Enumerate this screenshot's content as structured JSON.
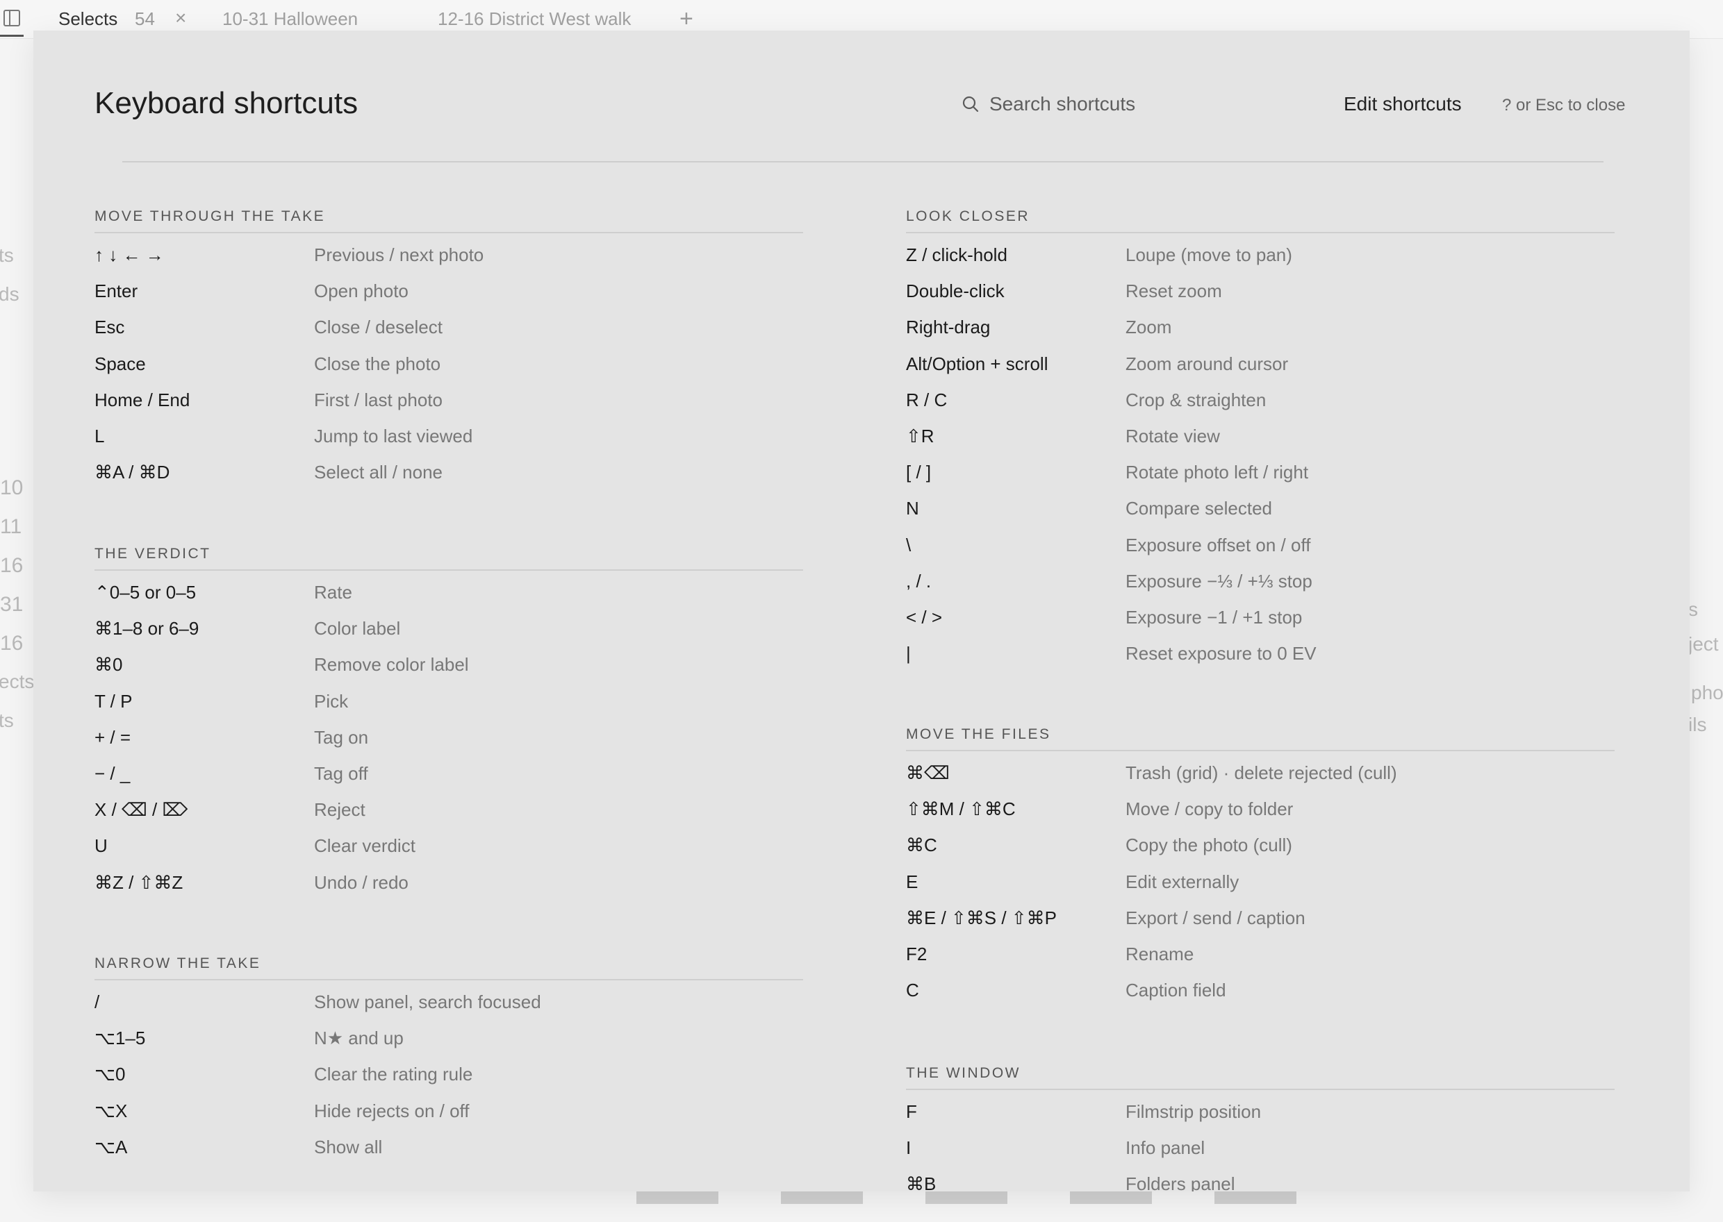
{
  "tabs": [
    {
      "label": "Selects",
      "count": "54"
    },
    {
      "label": "10-31 Halloween"
    },
    {
      "label": "12-16 District West walk"
    }
  ],
  "tab_close_glyph": "×",
  "tab_add_glyph": "+",
  "background_left": [
    "ts",
    "ds",
    "10",
    "11",
    "16",
    "31",
    "16",
    "ects",
    "ts"
  ],
  "background_right": [
    "s",
    "ject",
    "pho",
    "ils"
  ],
  "modal": {
    "title": "Keyboard shortcuts",
    "search_placeholder": "Search shortcuts",
    "edit_label": "Edit shortcuts",
    "close_hint": "? or Esc to close"
  },
  "sections": {
    "move_through": {
      "title": "MOVE THROUGH THE TAKE",
      "rows": [
        {
          "key": "↑ ↓ ← →",
          "desc": "Previous / next photo"
        },
        {
          "key": "Enter",
          "desc": "Open photo"
        },
        {
          "key": "Esc",
          "desc": "Close / deselect"
        },
        {
          "key": "Space",
          "desc": "Close the photo"
        },
        {
          "key": "Home / End",
          "desc": "First / last photo"
        },
        {
          "key": "L",
          "desc": "Jump to last viewed"
        },
        {
          "key": "⌘A / ⌘D",
          "desc": "Select all / none"
        }
      ]
    },
    "verdict": {
      "title": "THE VERDICT",
      "rows": [
        {
          "key": "⌃0–5 or 0–5",
          "desc": "Rate"
        },
        {
          "key": "⌘1–8 or 6–9",
          "desc": "Color label"
        },
        {
          "key": "⌘0",
          "desc": "Remove color label"
        },
        {
          "key": "T / P",
          "desc": "Pick"
        },
        {
          "key": "+ / =",
          "desc": "Tag on"
        },
        {
          "key": "− / _",
          "desc": "Tag off"
        },
        {
          "key": "X / ⌫ / ⌦",
          "desc": "Reject"
        },
        {
          "key": "U",
          "desc": "Clear verdict"
        },
        {
          "key": "⌘Z / ⇧⌘Z",
          "desc": "Undo / redo"
        }
      ]
    },
    "narrow": {
      "title": "NARROW THE TAKE",
      "rows": [
        {
          "key": "/",
          "desc": "Show panel, search focused"
        },
        {
          "key": "⌥1–5",
          "desc": "N★ and up"
        },
        {
          "key": "⌥0",
          "desc": "Clear the rating rule"
        },
        {
          "key": "⌥X",
          "desc": "Hide rejects on / off"
        },
        {
          "key": "⌥A",
          "desc": "Show all"
        }
      ]
    },
    "look_closer": {
      "title": "LOOK CLOSER",
      "rows": [
        {
          "key": "Z / click-hold",
          "desc": "Loupe (move to pan)"
        },
        {
          "key": "Double-click",
          "desc": "Reset zoom"
        },
        {
          "key": "Right-drag",
          "desc": "Zoom"
        },
        {
          "key": "Alt/Option + scroll",
          "desc": "Zoom around cursor"
        },
        {
          "key": "R / C",
          "desc": "Crop & straighten"
        },
        {
          "key": "⇧R",
          "desc": "Rotate view"
        },
        {
          "key": "[ / ]",
          "desc": "Rotate photo left / right"
        },
        {
          "key": "N",
          "desc": "Compare selected"
        },
        {
          "key": "\\",
          "desc": "Exposure offset on / off"
        },
        {
          "key": ", / .",
          "desc": "Exposure −⅓ / +⅓ stop"
        },
        {
          "key": "< / >",
          "desc": "Exposure −1 / +1 stop"
        },
        {
          "key": "|",
          "desc": "Reset exposure to 0 EV"
        }
      ]
    },
    "move_files": {
      "title": "MOVE THE FILES",
      "rows": [
        {
          "key": "⌘⌫",
          "desc": "Trash (grid) · delete rejected (cull)"
        },
        {
          "key": "⇧⌘M / ⇧⌘C",
          "desc": "Move / copy to folder"
        },
        {
          "key": "⌘C",
          "desc": "Copy the photo (cull)"
        },
        {
          "key": "E",
          "desc": "Edit externally"
        },
        {
          "key": "⌘E / ⇧⌘S / ⇧⌘P",
          "desc": "Export / send / caption"
        },
        {
          "key": "F2",
          "desc": "Rename"
        },
        {
          "key": "C",
          "desc": "Caption field"
        }
      ]
    },
    "window": {
      "title": "THE WINDOW",
      "rows": [
        {
          "key": "F",
          "desc": "Filmstrip position"
        },
        {
          "key": "I",
          "desc": "Info panel"
        },
        {
          "key": "⌘B",
          "desc": "Folders panel"
        }
      ]
    }
  }
}
